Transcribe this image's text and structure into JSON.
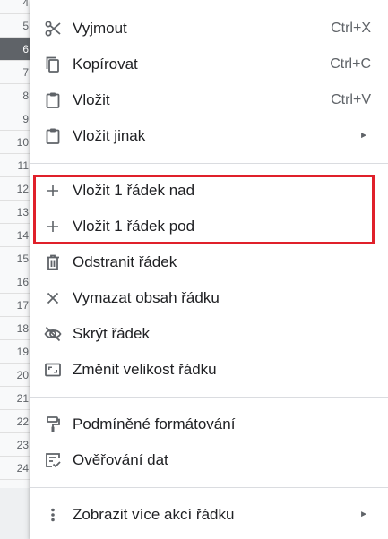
{
  "row_headers": [
    {
      "n": "4",
      "selected": false
    },
    {
      "n": "5",
      "selected": false
    },
    {
      "n": "6",
      "selected": true
    },
    {
      "n": "7",
      "selected": false
    },
    {
      "n": "8",
      "selected": false
    },
    {
      "n": "9",
      "selected": false
    },
    {
      "n": "10",
      "selected": false
    },
    {
      "n": "11",
      "selected": false
    },
    {
      "n": "12",
      "selected": false
    },
    {
      "n": "13",
      "selected": false
    },
    {
      "n": "14",
      "selected": false
    },
    {
      "n": "15",
      "selected": false
    },
    {
      "n": "16",
      "selected": false
    },
    {
      "n": "17",
      "selected": false
    },
    {
      "n": "18",
      "selected": false
    },
    {
      "n": "19",
      "selected": false
    },
    {
      "n": "20",
      "selected": false
    },
    {
      "n": "21",
      "selected": false
    },
    {
      "n": "22",
      "selected": false
    },
    {
      "n": "23",
      "selected": false
    },
    {
      "n": "24",
      "selected": false
    }
  ],
  "menu": {
    "cut": {
      "label": "Vyjmout",
      "shortcut": "Ctrl+X",
      "icon": "scissors-icon"
    },
    "copy": {
      "label": "Kopírovat",
      "shortcut": "Ctrl+C",
      "icon": "copy-icon"
    },
    "paste": {
      "label": "Vložit",
      "shortcut": "Ctrl+V",
      "icon": "clipboard-icon"
    },
    "paste_special": {
      "label": "Vložit jinak",
      "submenu_arrow": "►",
      "icon": "clipboard-icon"
    },
    "insert_above": {
      "label": "Vložit 1 řádek nad",
      "icon": "plus-icon"
    },
    "insert_below": {
      "label": "Vložit 1 řádek pod",
      "icon": "plus-icon"
    },
    "delete_row": {
      "label": "Odstranit řádek",
      "icon": "trash-icon"
    },
    "clear_row": {
      "label": "Vymazat obsah řádku",
      "icon": "close-icon"
    },
    "hide_row": {
      "label": "Skrýt řádek",
      "icon": "eye-off-icon"
    },
    "resize_row": {
      "label": "Změnit velikost řádku",
      "icon": "resize-icon"
    },
    "conditional_format": {
      "label": "Podmíněné formátování",
      "icon": "paint-roller-icon"
    },
    "data_validation": {
      "label": "Ověřování dat",
      "icon": "checklist-icon"
    },
    "more_actions": {
      "label": "Zobrazit více akcí řádku",
      "submenu_arrow": "►",
      "icon": "more-vert-icon"
    }
  },
  "colors": {
    "highlight_border": "#e0202a",
    "selected_row_header": "#5f6368",
    "icon": "#5f6368",
    "text": "#202124"
  }
}
